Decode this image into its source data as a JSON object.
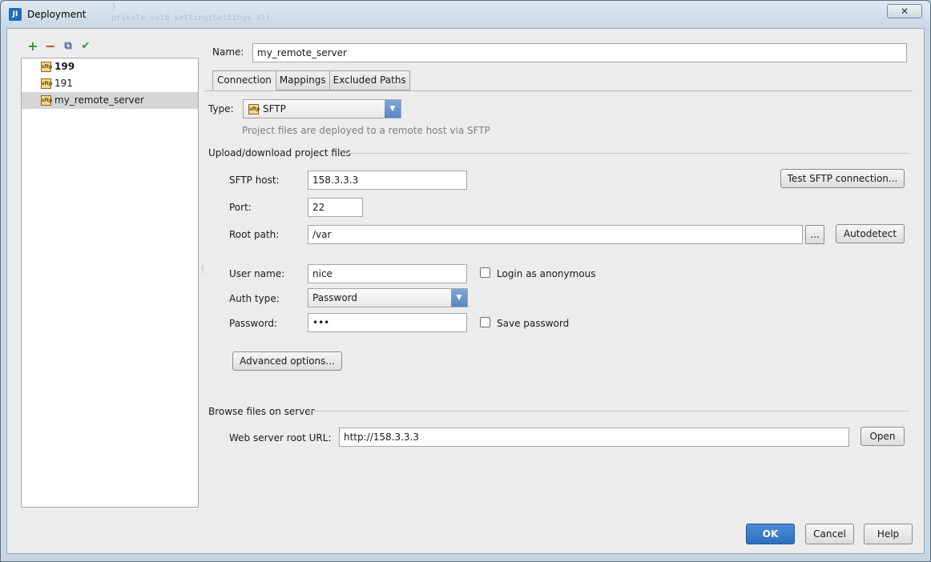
{
  "window": {
    "title": "Deployment",
    "close_label": "✕",
    "app_icon_label": "JI"
  },
  "toolbar": {
    "add": "+",
    "remove": "−",
    "copy": "⧉",
    "check": "✔"
  },
  "servers": [
    {
      "name": "199",
      "bold": true,
      "selected": false
    },
    {
      "name": "191",
      "bold": false,
      "selected": false
    },
    {
      "name": "my_remote_server",
      "bold": false,
      "selected": true
    }
  ],
  "sftp_icon_label": "sftp",
  "form": {
    "name_label": "Name:",
    "name_value": "my_remote_server",
    "tabs": [
      "Connection",
      "Mappings",
      "Excluded Paths"
    ],
    "type_label": "Type:",
    "type_value": "SFTP",
    "type_hint": "Project files are deployed to a remote host via SFTP",
    "upload_section": "Upload/download project files",
    "sftp_host_label": "SFTP host:",
    "sftp_host_value": "158.3.3.3",
    "test_button": "Test SFTP connection...",
    "port_label": "Port:",
    "port_value": "22",
    "root_path_label": "Root path:",
    "root_path_value": "/var",
    "browse_button": "...",
    "autodetect_button": "Autodetect",
    "user_name_label": "User name:",
    "user_name_value": "nice",
    "anonymous_label": "Login as anonymous",
    "auth_type_label": "Auth type:",
    "auth_type_value": "Password",
    "password_label": "Password:",
    "password_value": "•••",
    "save_password_label": "Save password",
    "advanced_button": "Advanced options...",
    "browse_section": "Browse files on server",
    "web_root_label": "Web server root URL:",
    "web_root_value": "http://158.3.3.3",
    "open_button": "Open"
  },
  "footer": {
    "ok": "OK",
    "cancel": "Cancel",
    "help": "Help"
  }
}
